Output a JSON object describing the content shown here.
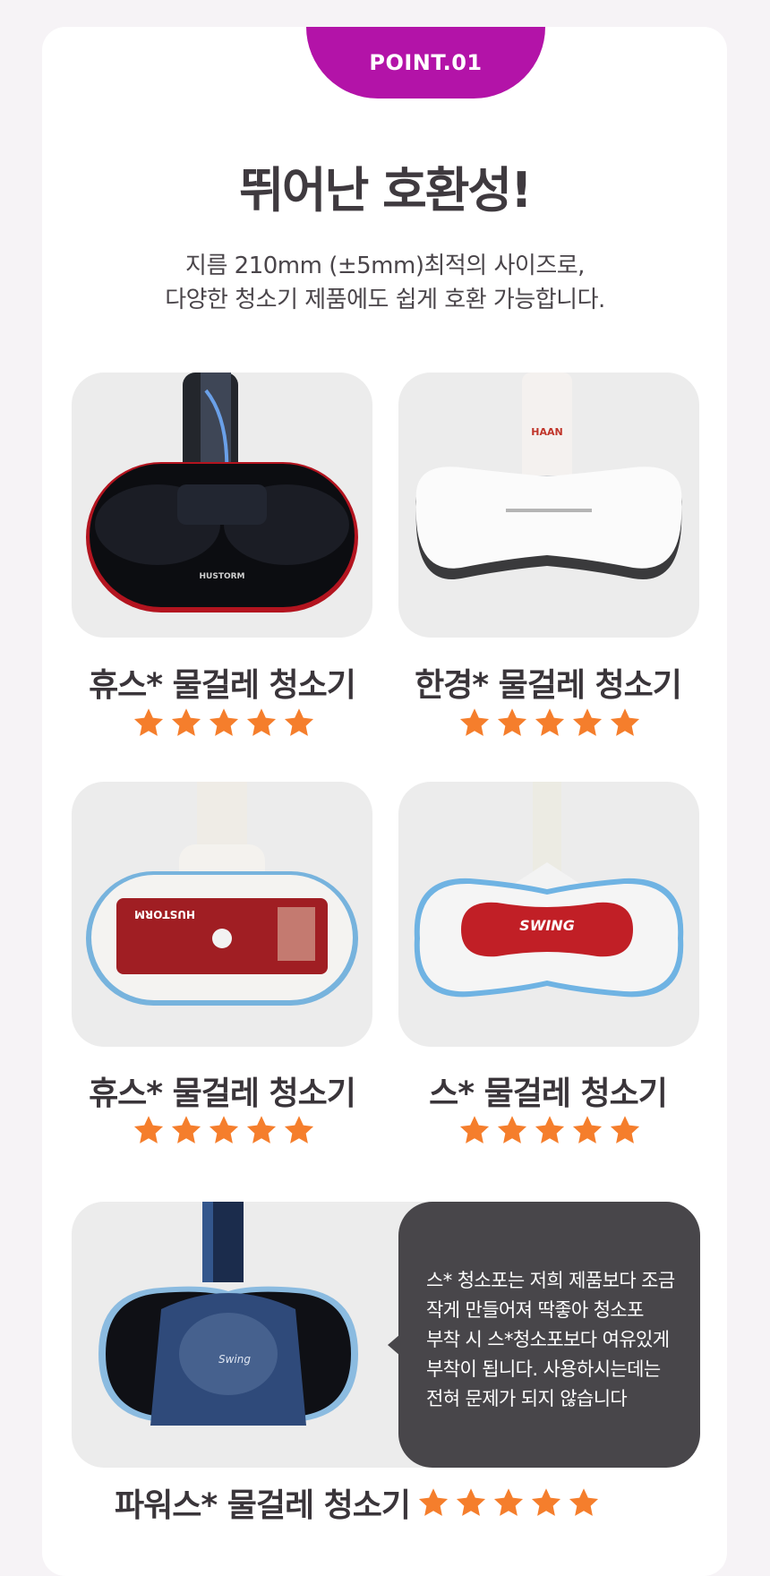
{
  "badge": "POINT.01",
  "headline": "뛰어난 호환성!",
  "subtitle": {
    "line1": "지름 210mm (±5mm)최적의 사이즈로,",
    "line2": "다양한 청소기 제품에도 쉽게 호환 가능합니다."
  },
  "products": [
    {
      "caption": "휴스* 물걸레 청소기",
      "rating": 5,
      "image_text": "HUSTORM"
    },
    {
      "caption": "한경* 물걸레 청소기",
      "rating": 5,
      "image_text": "HAAN"
    },
    {
      "caption": "휴스* 물걸레 청소기",
      "rating": 5,
      "image_text": "HUSTORM"
    },
    {
      "caption": "스*  물걸레 청소기",
      "rating": 5,
      "image_text": "SWING"
    }
  ],
  "featured": {
    "caption": "파워스* 물걸레 청소기",
    "rating": 5,
    "image_text": "Swing",
    "bubble": [
      "스* 청소포는 저희 제품보다 조금",
      "작게 만들어져 딱좋아 청소포",
      "부착 시 스*청소포보다 여유있게",
      "부착이 됩니다.  사용하시는데는",
      "전혀 문제가 되지 않습니다"
    ]
  },
  "colors": {
    "accent": "#b313a8",
    "star": "#f57e2c",
    "bubble": "#48464a"
  },
  "icons": {
    "rating": "star-icon"
  }
}
